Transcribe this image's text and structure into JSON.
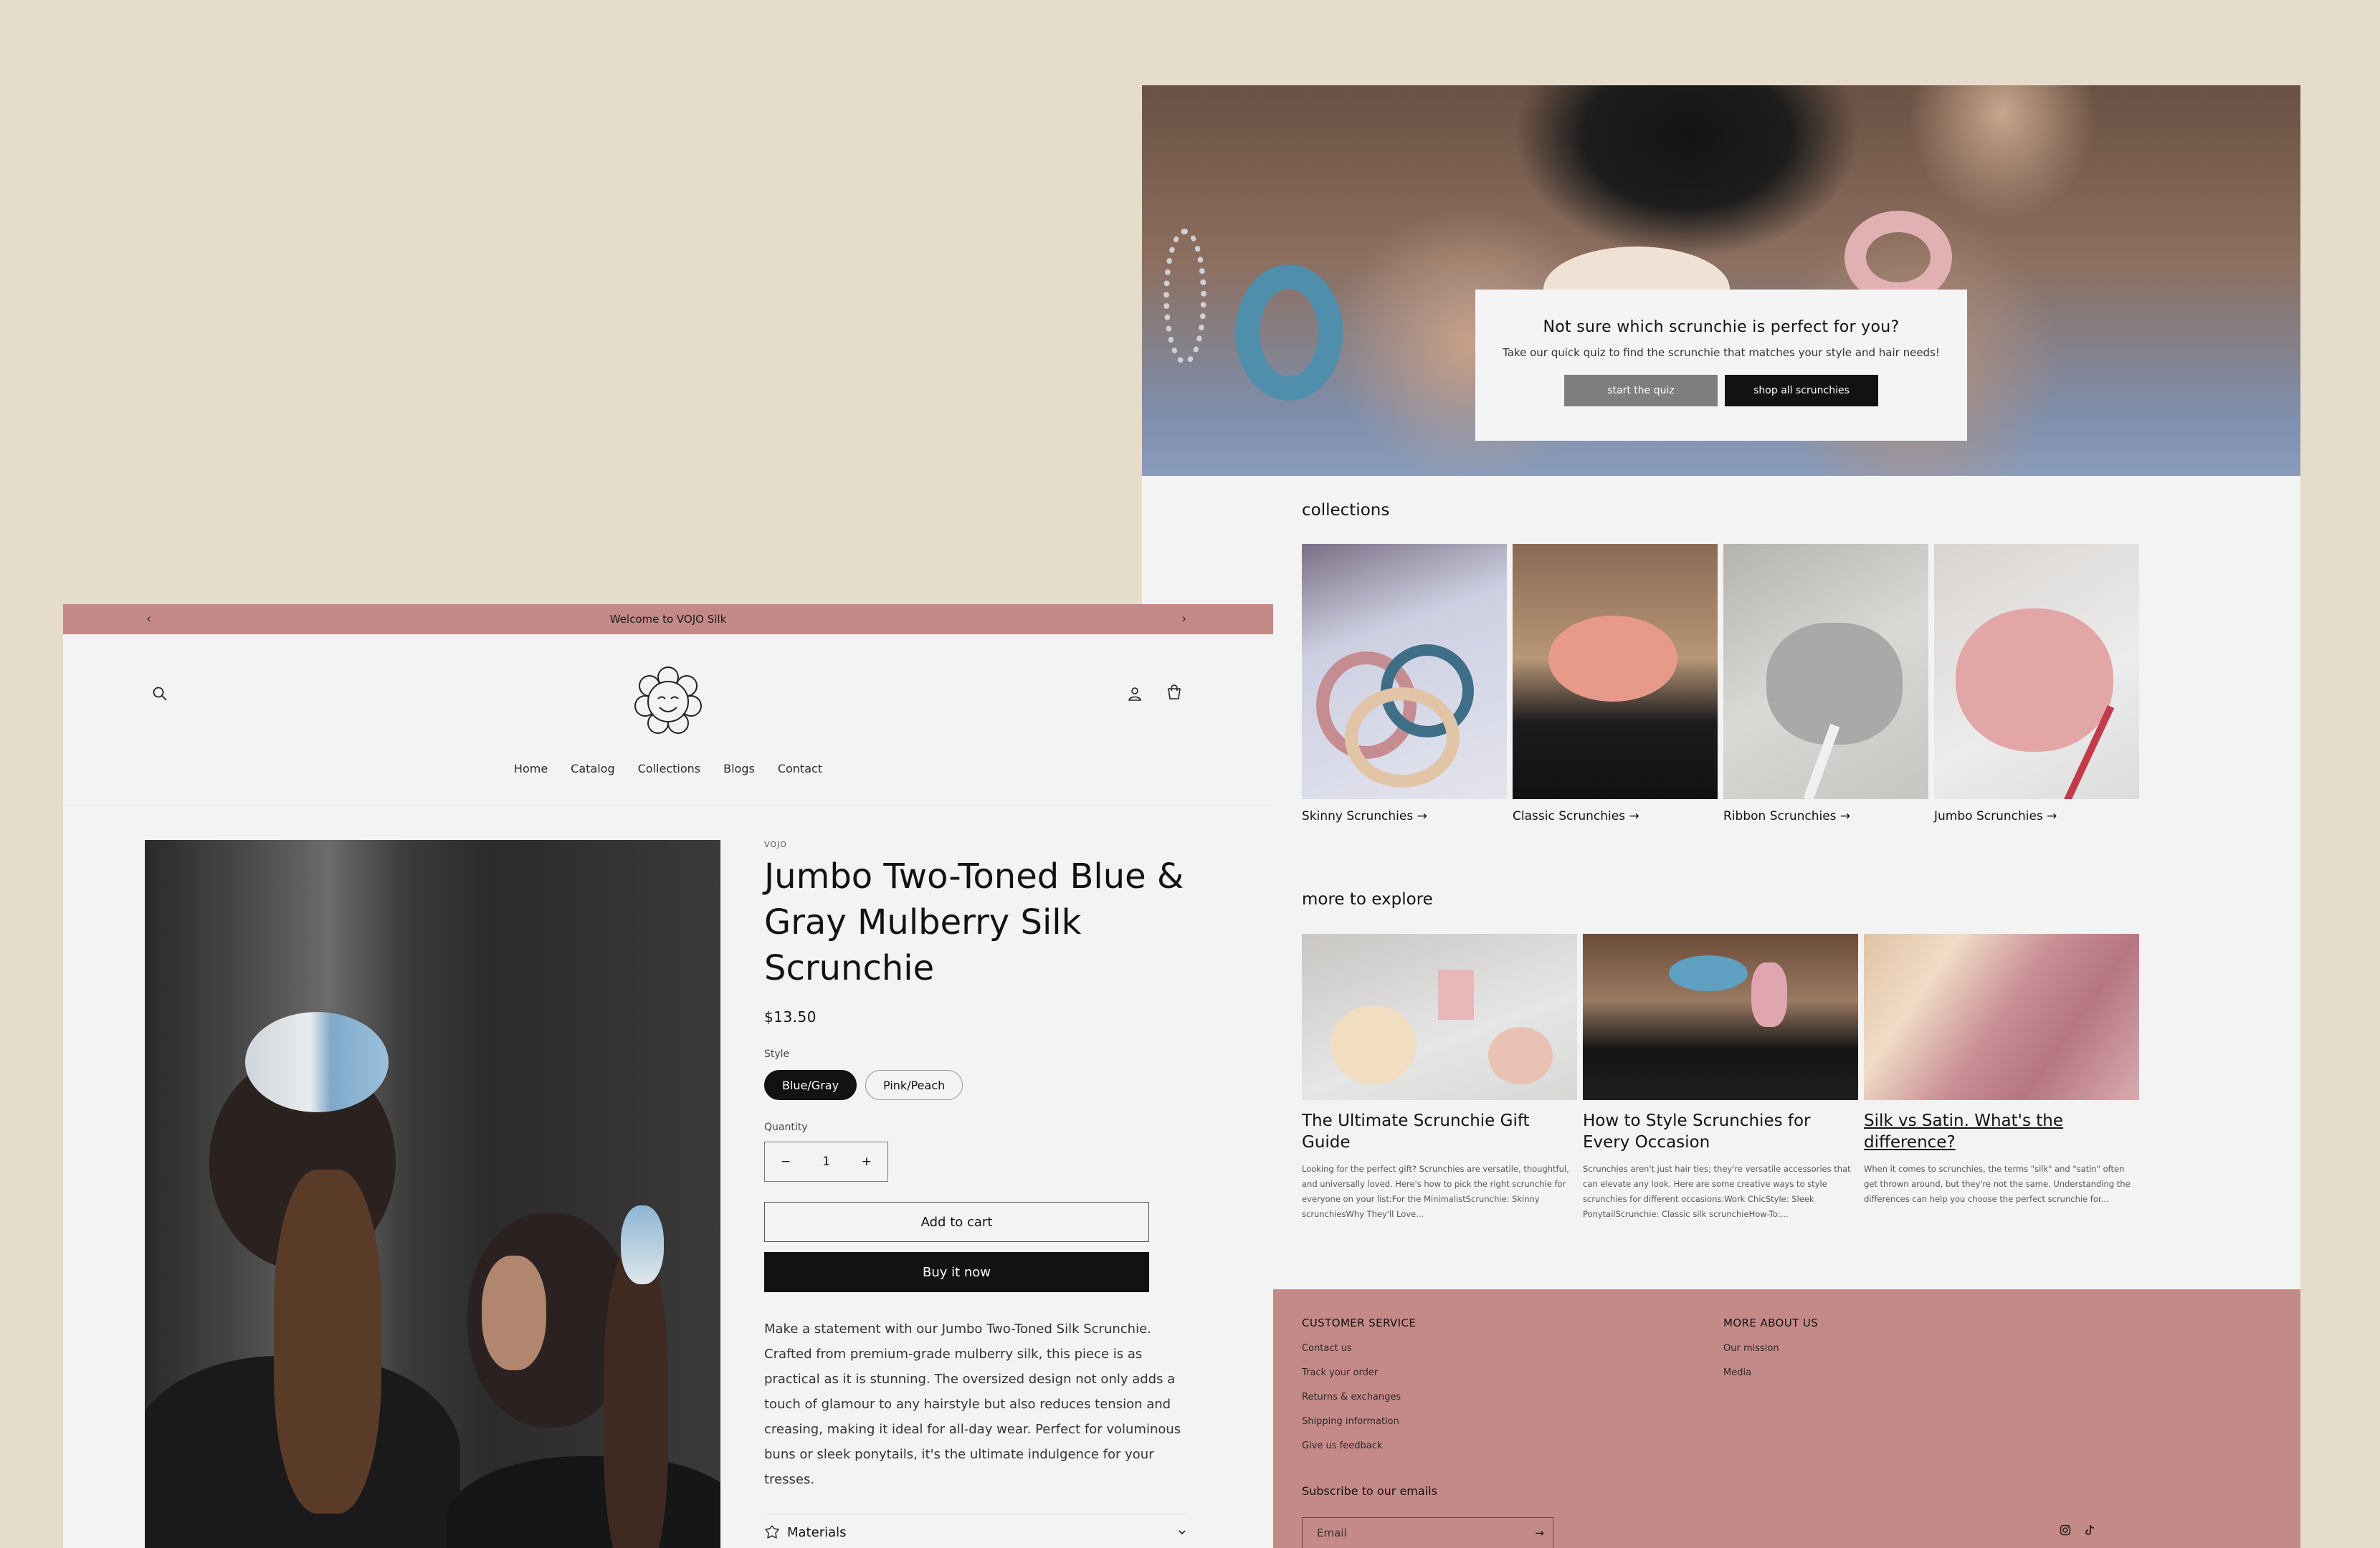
{
  "home": {
    "hero": {
      "heading": "Not sure which scrunchie is perfect for you?",
      "subtext": "Take our quick quiz to find the scrunchie that matches your style and hair needs!",
      "quiz_button": "start the quiz",
      "shop_button": "shop all scrunchies"
    },
    "collections": {
      "title": "collections",
      "items": [
        {
          "label": "Skinny Scrunchies →"
        },
        {
          "label": "Classic Scrunchies →"
        },
        {
          "label": "Ribbon Scrunchies →"
        },
        {
          "label": "Jumbo Scrunchies →"
        }
      ]
    },
    "explore": {
      "title": "more to explore",
      "posts": [
        {
          "title": "The Ultimate Scrunchie Gift Guide",
          "excerpt": "Looking for the perfect gift? Scrunchies are versatile, thoughtful, and universally loved. Here's how to pick the right scrunchie for everyone on your list:For the MinimalistScrunchie: Skinny scrunchiesWhy They'll Love..."
        },
        {
          "title": "How to Style Scrunchies for Every Occasion",
          "excerpt": "Scrunchies aren't just hair ties; they're versatile accessories that can elevate any look. Here are some creative ways to style scrunchies for different occasions:Work ChicStyle: Sleek PonytailScrunchie: Classic silk scrunchieHow-To:..."
        },
        {
          "title": "Silk vs Satin. What's the difference?",
          "excerpt": "When it comes to scrunchies, the terms \"silk\" and \"satin\" often get thrown around, but they're not the same. Understanding the differences can help you choose the perfect scrunchie for..."
        }
      ]
    },
    "footer": {
      "customer_service": {
        "heading": "CUSTOMER SERVICE",
        "links": [
          "Contact us",
          "Track your order",
          "Returns & exchanges",
          "Shipping information",
          "Give us feedback"
        ]
      },
      "more_about": {
        "heading": "MORE ABOUT US",
        "links": [
          "Our mission",
          "Media"
        ]
      },
      "subscribe_title": "Subscribe to our emails",
      "email_placeholder": "Email",
      "submit_arrow": "→",
      "social_icons": [
        "instagram-icon",
        "tiktok-icon"
      ]
    }
  },
  "product_page": {
    "announcement": "Welcome to VOJO Silk",
    "nav": [
      "Home",
      "Catalog",
      "Collections",
      "Blogs",
      "Contact"
    ],
    "vendor": "VOJO",
    "title": "Jumbo Two-Toned Blue & Gray Mulberry Silk Scrunchie",
    "price": "$13.50",
    "style_label": "Style",
    "styles": [
      "Blue/Gray",
      "Pink/Peach"
    ],
    "selected_style": "Blue/Gray",
    "quantity_label": "Quantity",
    "quantity": "1",
    "qty_minus": "−",
    "qty_plus": "+",
    "add_to_cart": "Add to cart",
    "buy_now": "Buy it now",
    "description": "Make a statement with our Jumbo Two-Toned Silk Scrunchie. Crafted from premium-grade mulberry silk, this piece is as practical as it is stunning. The oversized design not only adds a touch of glamour to any hairstyle but also reduces tension and creasing, making it ideal for all-day wear. Perfect for voluminous buns or sleek ponytails, it's the ultimate indulgence for your tresses.",
    "materials_label": "Materials"
  },
  "colors": {
    "background": "#e6dccb",
    "page": "#f3f3f3",
    "accent_pink": "#c48a88",
    "dark": "#121212",
    "quiz_gray": "#7e7e7e"
  }
}
